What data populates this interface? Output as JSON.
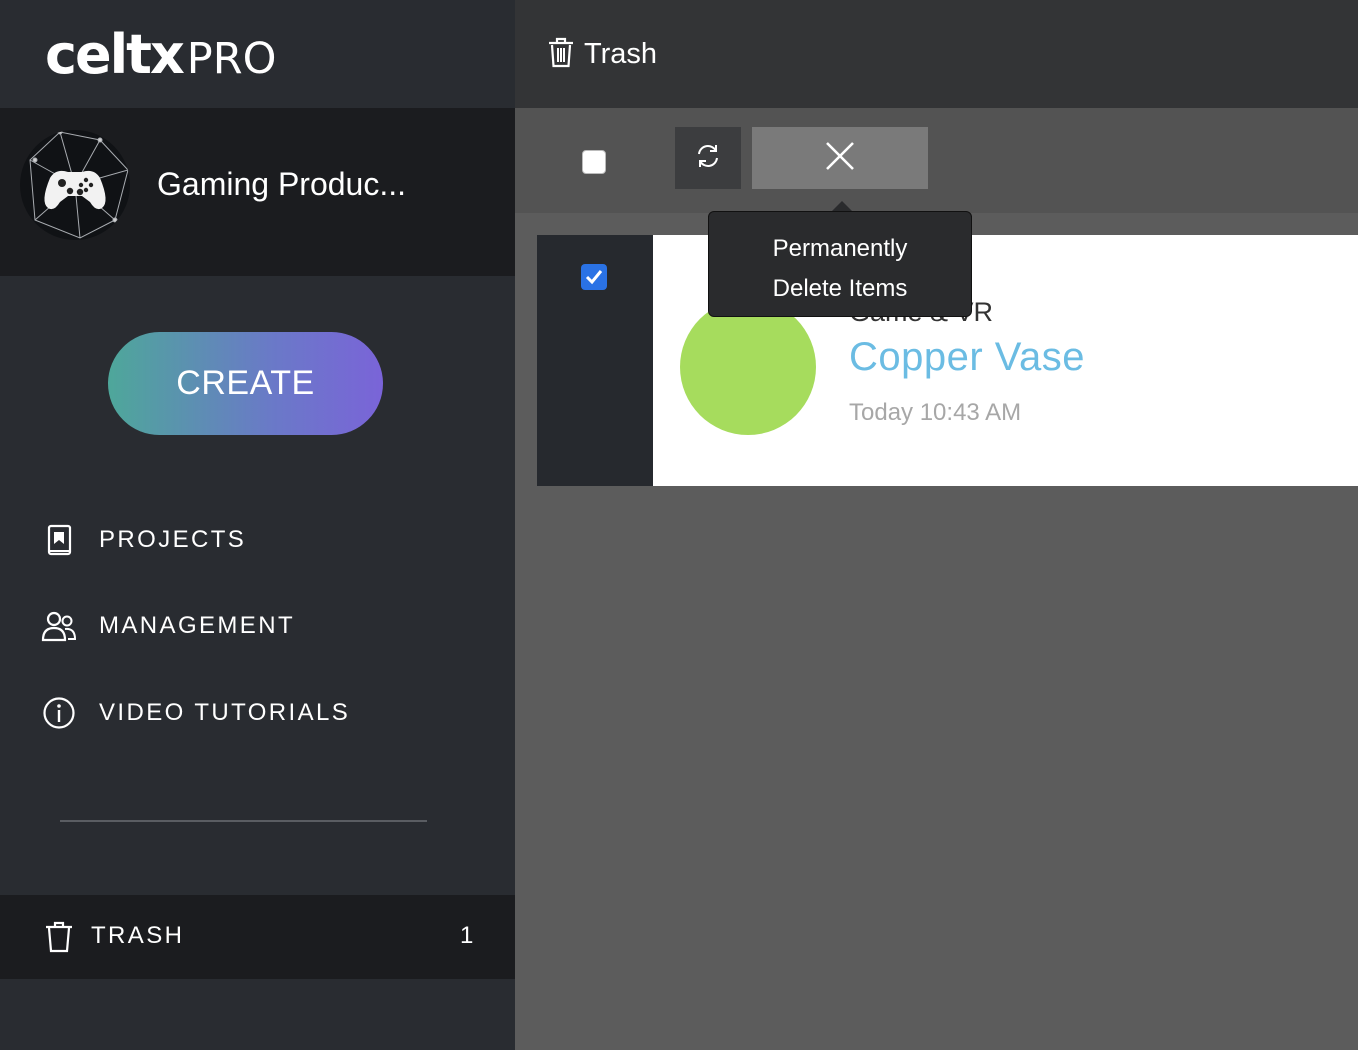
{
  "app": {
    "logo_main": "celtx",
    "logo_pro": "PRO"
  },
  "org": {
    "name": "Gaming Produc..."
  },
  "sidebar": {
    "create_label": "CREATE",
    "items": [
      {
        "label": "PROJECTS",
        "icon": "bookmark-book-icon"
      },
      {
        "label": "MANAGEMENT",
        "icon": "users-icon"
      },
      {
        "label": "VIDEO TUTORIALS",
        "icon": "info-circle-icon"
      }
    ],
    "trash": {
      "label": "TRASH",
      "count": "1",
      "icon": "trash-icon"
    }
  },
  "header": {
    "title": "Trash",
    "icon": "trash-icon"
  },
  "toolbar": {
    "select_all_checked": false,
    "restore_icon": "refresh-icon",
    "delete_icon": "close-icon"
  },
  "tooltip": {
    "line1": "Permanently",
    "line2": "Delete Items"
  },
  "items": [
    {
      "checked": true,
      "category": "Game & VR",
      "title": "Copper Vase",
      "date": "Today 10:43 AM",
      "color": "#a6dc5d"
    }
  ],
  "colors": {
    "accent_link": "#6bbce3",
    "check_blue": "#2a72e5",
    "sidebar_bg": "#292c31",
    "sidebar_dark": "#1b1c1f"
  }
}
